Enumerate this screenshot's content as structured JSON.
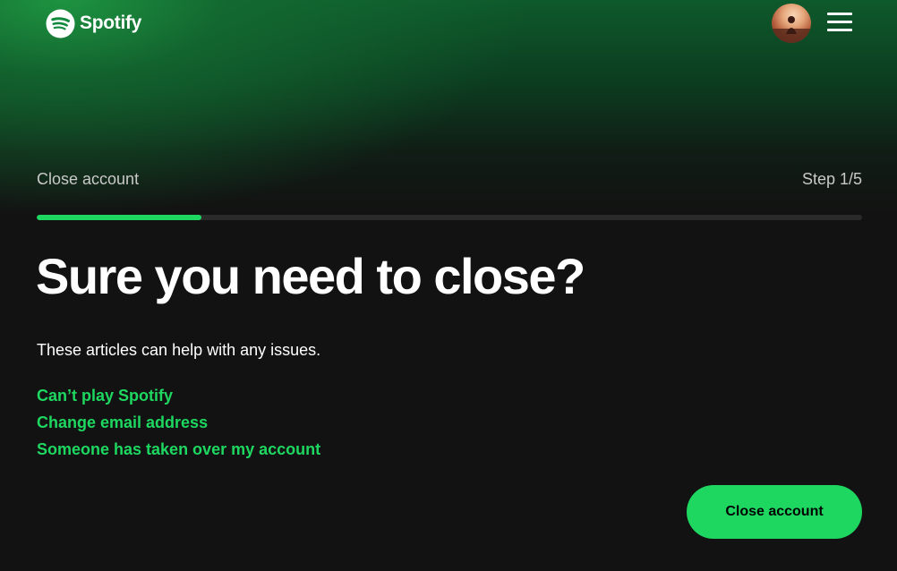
{
  "header": {
    "logo_text": "Spotify",
    "logo_icon": "spotify-logo-icon",
    "avatar_icon": "user-avatar",
    "menu_icon": "hamburger-menu-icon"
  },
  "progress": {
    "title": "Close account",
    "step_label": "Step 1/5",
    "current_step": 1,
    "total_steps": 5,
    "fraction": 0.2
  },
  "main": {
    "headline": "Sure you need to close?",
    "help_text": "These articles can help with any issues.",
    "links": [
      "Can’t play Spotify",
      "Change email address",
      "Someone has taken over my account"
    ],
    "close_button_label": "Close account"
  },
  "colors": {
    "accent": "#1ed760",
    "background": "#121212",
    "gradient_top": "#1e9641"
  }
}
